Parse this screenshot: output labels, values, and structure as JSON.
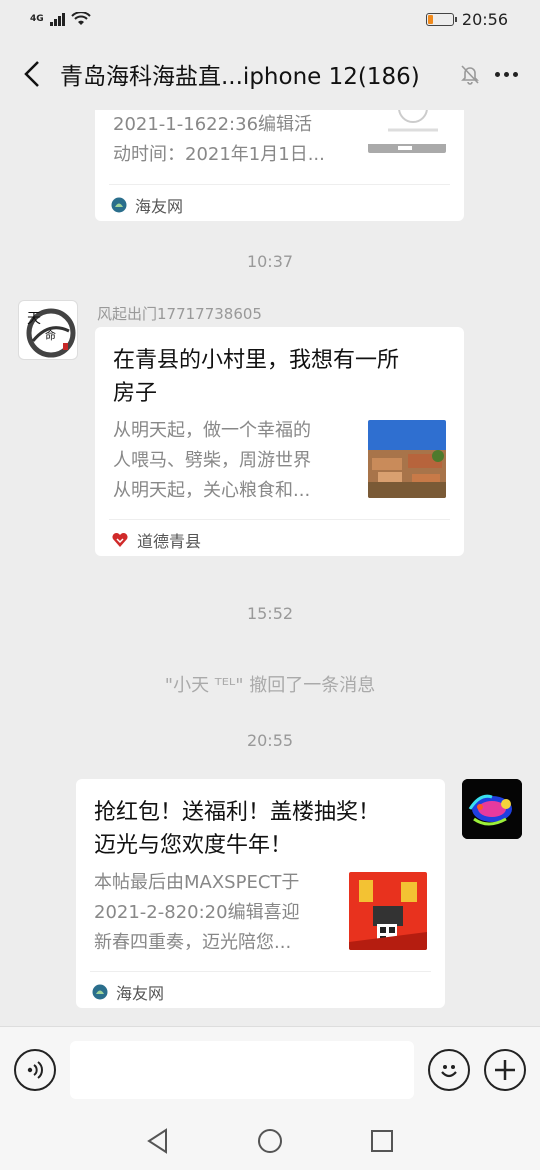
{
  "status": {
    "network": "4G",
    "time": "20:56",
    "battery_level": 0.22,
    "battery_color": "#f08a1c"
  },
  "header": {
    "title": "青岛海科海盐直...iphone 12(186)"
  },
  "messages": {
    "card1": {
      "desc_line1": "2021-1-1622:36编辑活",
      "desc_line2": "动时间：2021年1月1日...",
      "source": "海友网"
    },
    "time1": "10:37",
    "sender2": "风起出门17717738605",
    "card2": {
      "title_line1": "在青县的小村里，我想有一所",
      "title_line2": "房子",
      "desc_line1": "从明天起，做一个幸福的",
      "desc_line2": "人喂马、劈柴，周游世界",
      "desc_line3": "从明天起，关心粮食和...",
      "source": "道德青县"
    },
    "time2": "15:52",
    "recall_notice": "\"小天 ᵀᴱᴸ\" 撤回了一条消息",
    "time3": "20:55",
    "card3": {
      "title_line1": "抢红包！送福利！盖楼抽奖！",
      "title_line2": "迈光与您欢度牛年！",
      "desc_line1": "本帖最后由MAXSPECT于",
      "desc_line2": "2021-2-820:20编辑喜迎",
      "desc_line3": "新春四重奏，迈光陪您...",
      "source": "海友网"
    }
  },
  "colors": {
    "background": "#ededed",
    "card": "#ffffff",
    "muted_text": "#999999",
    "accent_red": "#e8321e"
  },
  "icons": [
    "back-icon",
    "mute-bell-icon",
    "more-icon",
    "voice-icon",
    "emoji-icon",
    "add-icon",
    "nav-back-icon",
    "nav-home-icon",
    "nav-recent-icon"
  ]
}
